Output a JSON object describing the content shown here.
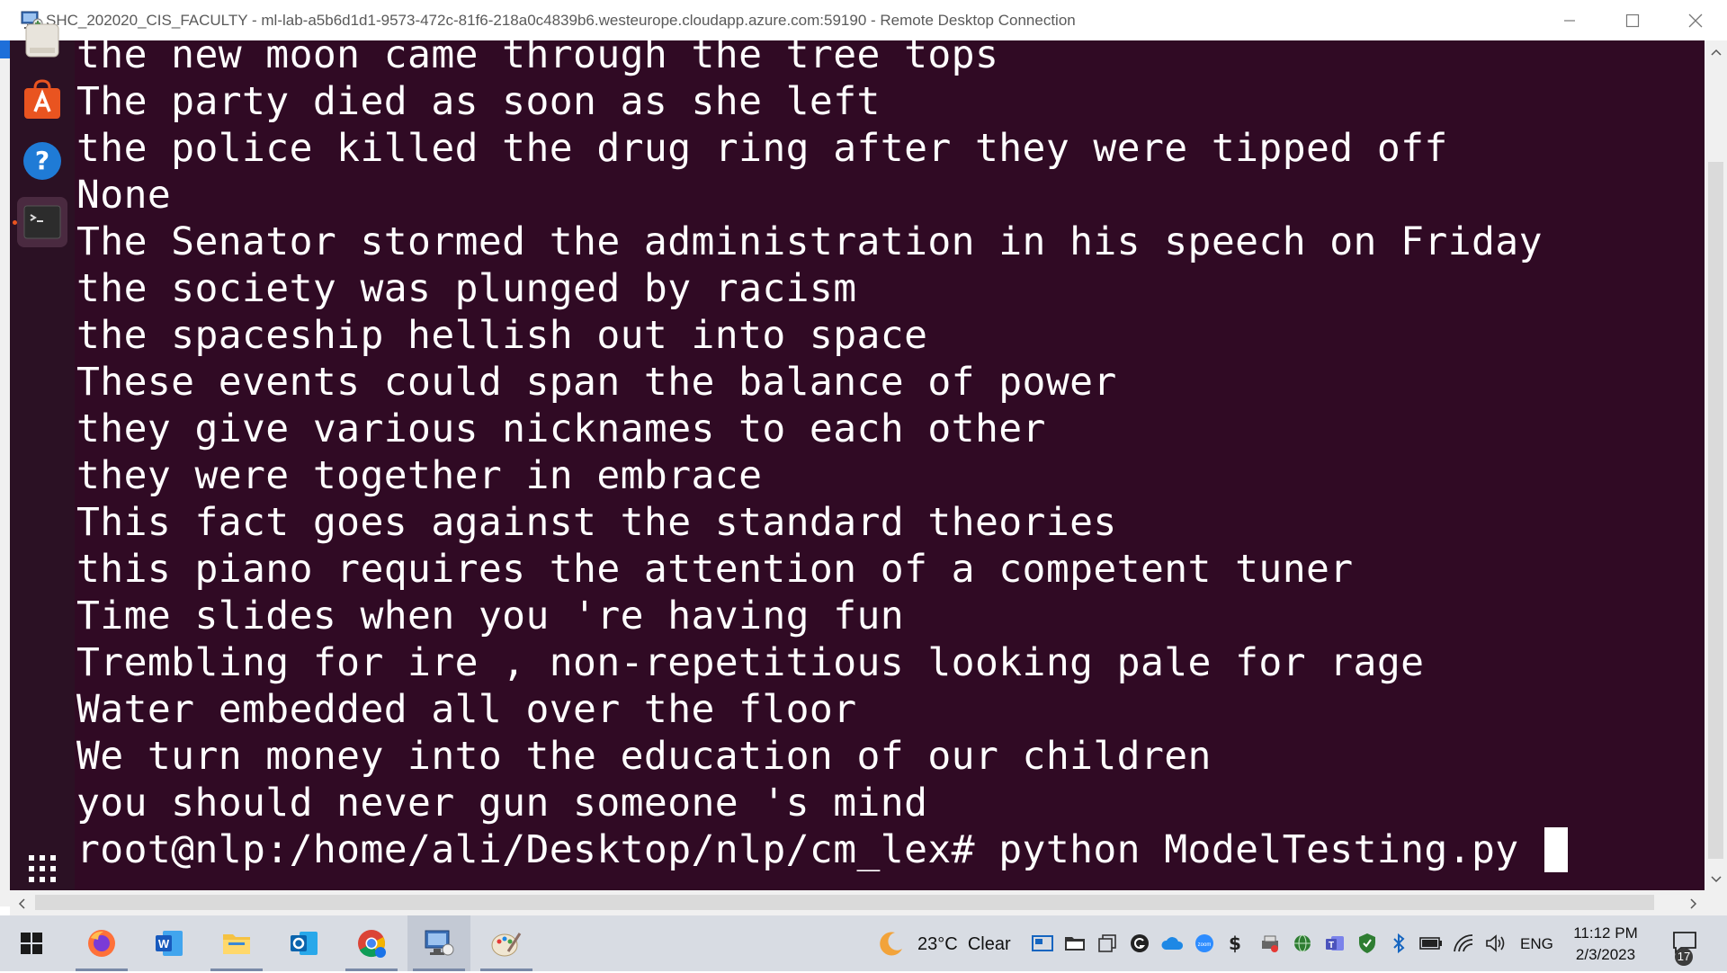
{
  "window": {
    "title": "SHC_202020_CIS_FACULTY - ml-lab-a5b6d1d1-9573-472c-81f6-218a0c4839b6.westeurope.cloudapp.azure.com:59190 - Remote Desktop Connection"
  },
  "terminal": {
    "lines": [
      "the new moon came through the tree tops",
      "The party died as soon as she left",
      "the police killed the drug ring after they were tipped off",
      "None",
      "The Senator stormed the administration in his speech on Friday",
      "the society was plunged by racism",
      "the spaceship hellish out into space",
      "These events could span the balance of power",
      "they give various nicknames to each other",
      "they were together in embrace",
      "This fact goes against the standard theories",
      "this piano requires the attention of a competent tuner",
      "Time slides when you 're having fun",
      "Trembling for ire , non-repetitious looking pale for rage",
      "Water embedded all over the floor",
      "We turn money into the education of our children",
      "you should never gun someone 's mind"
    ],
    "prompt": "root@nlp:/home/ali/Desktop/nlp/cm_lex#",
    "command": " python ModelTesting.py "
  },
  "dock": {
    "items": [
      "files-icon",
      "ubuntu-software-icon",
      "help-icon",
      "terminal-icon",
      "show-applications-icon"
    ]
  },
  "taskbar": {
    "apps": [
      "start-icon",
      "firefox-icon",
      "word-icon",
      "file-explorer-icon",
      "outlook-icon",
      "chrome-icon",
      "remote-desktop-icon",
      "paint-icon"
    ],
    "weather": {
      "temp": "23°C",
      "condition": "Clear"
    },
    "language": "ENG",
    "time": "11:12 PM",
    "date": "2/3/2023",
    "notifications": "17"
  },
  "colors": {
    "terminal_bg": "#300a24",
    "dock_bg": "#2b1124",
    "ubuntu_orange": "#e95420",
    "taskbar_bg": "#d8dce3"
  }
}
